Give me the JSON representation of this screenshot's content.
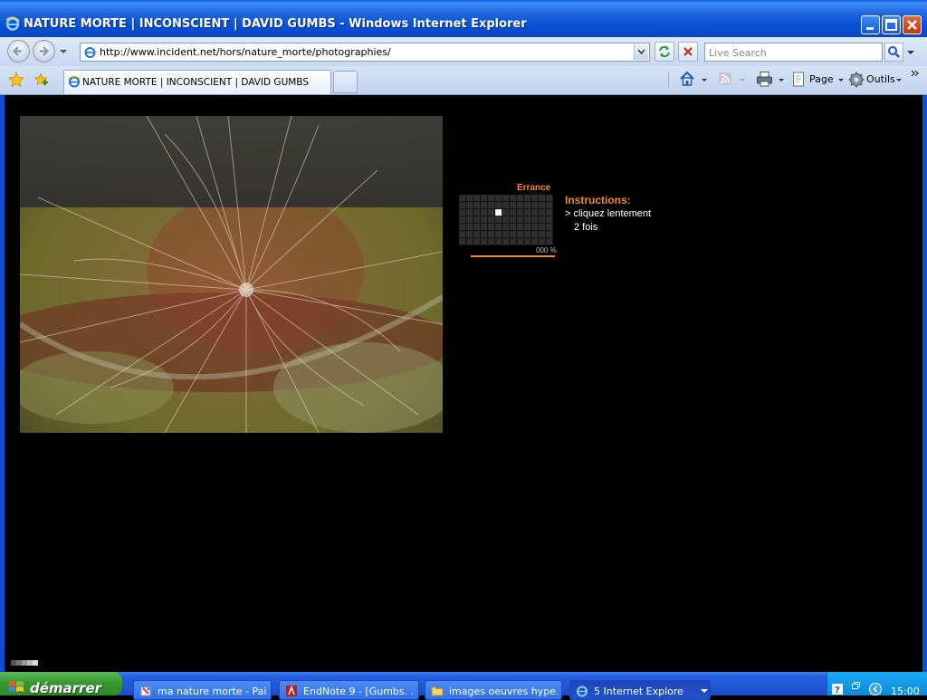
{
  "window": {
    "title": "NATURE MORTE | INCONSCIENT | DAVID GUMBS - Windows Internet Explorer"
  },
  "address_bar": {
    "url": "http://www.incident.net/hors/nature_morte/photographies/"
  },
  "search": {
    "placeholder": "Live Search"
  },
  "tabs": [
    {
      "label": "NATURE MORTE | INCONSCIENT | DAVID GUMBS"
    }
  ],
  "command_bar": {
    "page_label": "Page",
    "tools_label": "Outils"
  },
  "page": {
    "grid_title": "Errance",
    "grid": {
      "cols": 13,
      "rows": 7,
      "active_cell": {
        "row": 2,
        "col": 5
      }
    },
    "instructions_title": "Instructions:",
    "instructions_line1": "> cliquez lentement",
    "instructions_line2": "2 fois",
    "progress_text": "000 %"
  },
  "taskbar": {
    "start_label": "démarrer",
    "items": [
      {
        "label": "ma nature morte - Paint",
        "icon": "paint-icon"
      },
      {
        "label": "EndNote 9 - [Gumbs. ...",
        "icon": "endnote-icon"
      },
      {
        "label": "images oeuvres hype...",
        "icon": "folder-icon"
      },
      {
        "label": "5 Internet Explorer",
        "icon": "ie-icon"
      }
    ],
    "clock": "15:00"
  },
  "colors": {
    "accent_orange": "#f18a22",
    "xp_blue": "#0b4fd4",
    "start_green": "#37982f"
  }
}
